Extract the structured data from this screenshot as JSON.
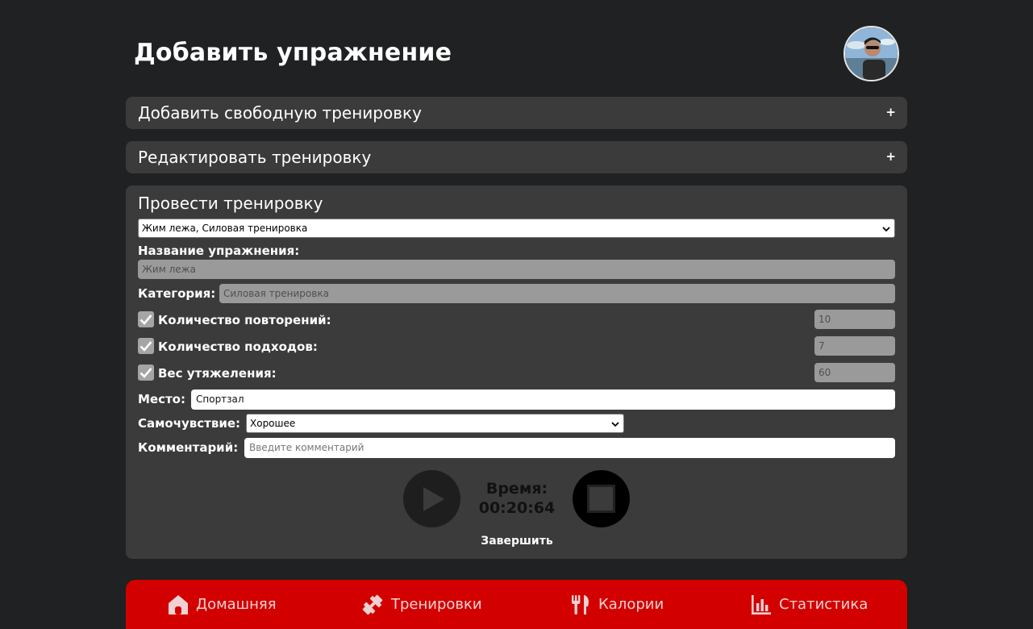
{
  "header": {
    "title": "Добавить упражнение"
  },
  "accordions": {
    "free_workout": {
      "label": "Добавить свободную тренировку",
      "toggle": "+"
    },
    "edit_workout": {
      "label": "Редактировать тренировку",
      "toggle": "+"
    }
  },
  "conduct": {
    "title": "Провести тренировку",
    "workout_select": "Жим лежа, Силовая тренировка",
    "exercise_name_label": "Название упражнения:",
    "exercise_name_value": "Жим лежа",
    "category_label": "Категория:",
    "category_value": "Силовая тренировка",
    "reps_label": "Количество повторений:",
    "reps_value": "10",
    "reps_checked": true,
    "sets_label": "Количество подходов:",
    "sets_value": "7",
    "sets_checked": true,
    "weight_label": "Вес утяжеления:",
    "weight_value": "60",
    "weight_checked": true,
    "place_label": "Место:",
    "place_value": "Спортзал",
    "wellbeing_label": "Самочувствие:",
    "wellbeing_value": "Хорошее",
    "comment_label": "Комментарий:",
    "comment_placeholder": "Введите комментарий",
    "time_label": "Время:",
    "time_value": "00:20:64",
    "finish_label": "Завершить"
  },
  "nav": {
    "home": "Домашняя",
    "workouts": "Тренировки",
    "calories": "Калории",
    "stats": "Статистика"
  },
  "colors": {
    "background": "#1f2123",
    "card": "#3b3b3b",
    "accent": "#d30000"
  }
}
